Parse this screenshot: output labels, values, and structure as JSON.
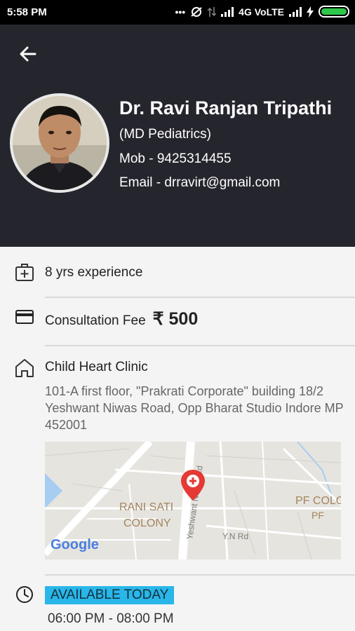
{
  "status_bar": {
    "time": "5:58 PM",
    "network": "4G VoLTE",
    "icons": [
      "dots-icon",
      "alarm-off-icon",
      "data-icon",
      "signal-icon",
      "signal-icon",
      "charging-icon",
      "battery-icon"
    ]
  },
  "header": {
    "back_icon": "arrow-left-icon",
    "doctor_name": "Dr. Ravi Ranjan Tripathi",
    "qualification": "(MD Pediatrics)",
    "mobile": "Mob - 9425314455",
    "email": "Email - drravirt@gmail.com"
  },
  "details": {
    "experience": "8 yrs experience",
    "fee_label": "Consultation Fee",
    "fee_amount": "₹ 500",
    "clinic_name": "Child Heart Clinic",
    "clinic_address": "101-A first floor, \"Prakrati Corporate\" building 18/2 Yeshwant Niwas Road, Opp Bharat Studio Indore MP 452001"
  },
  "map": {
    "labels": {
      "area1_line1": "RANI SATI",
      "area1_line2": "COLONY",
      "area2_line1": "PF COLO",
      "area2_line2": "PF",
      "road1": "Yeshwant Niwas Rd",
      "road2": "Y.N Rd",
      "logo": "Google"
    },
    "colors": {
      "background": "#e6e4df",
      "road": "#ffffff",
      "marker": "#e53935",
      "water": "#a7cdf2"
    }
  },
  "availability": {
    "badge": "AVAILABLE TODAY",
    "timing": "06:00 PM - 08:00 PM"
  },
  "colors": {
    "header_bg": "#25252d",
    "badge_bg": "#29b6e8",
    "page_bg": "#f4f4f4"
  }
}
